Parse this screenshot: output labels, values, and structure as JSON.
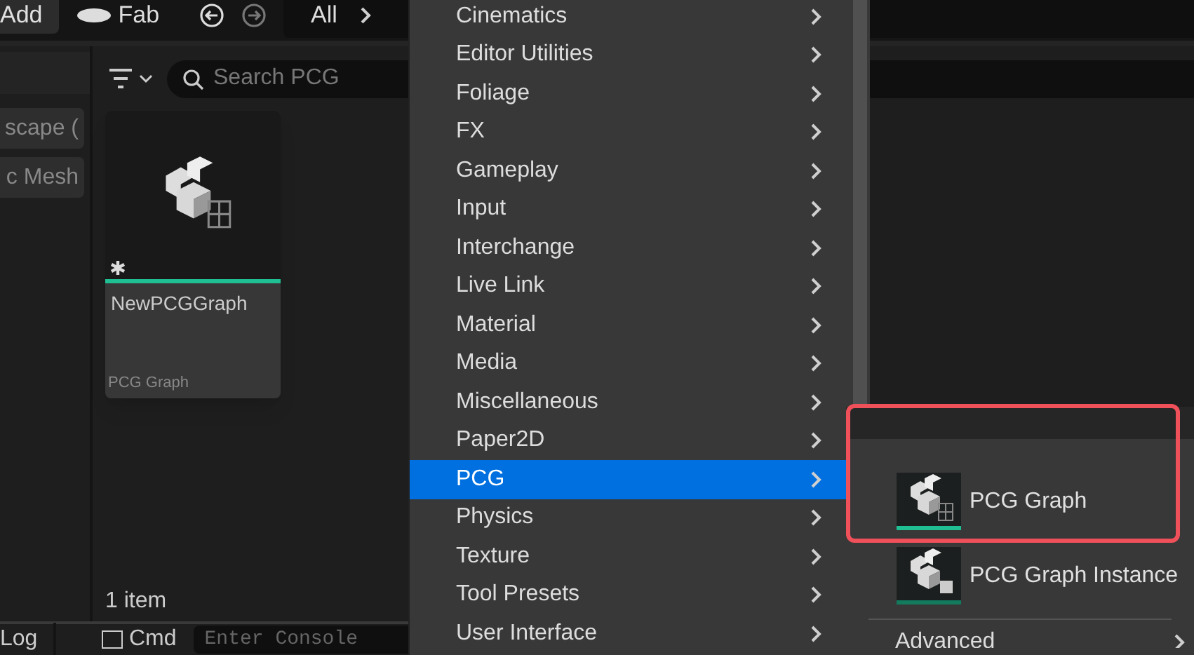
{
  "toolbar": {
    "add_button": "Add",
    "fab_button": "Fab",
    "breadcrumb": [
      "All"
    ]
  },
  "sidebar": {
    "items": [
      "scape (",
      "c Mesh"
    ]
  },
  "browser": {
    "search": {
      "placeholder": "Search PCG"
    },
    "assets": [
      {
        "name": "NewPCGGraph",
        "type": "PCG Graph",
        "unsaved": true
      }
    ],
    "item_count": "1 item"
  },
  "bottom_bar": {
    "log_tab": "Log",
    "cmd_button": "Cmd",
    "console": {
      "placeholder": "Enter Console"
    }
  },
  "menu": {
    "items": [
      {
        "label": "Cinematics",
        "selected": false
      },
      {
        "label": "Editor Utilities",
        "selected": false
      },
      {
        "label": "Foliage",
        "selected": false
      },
      {
        "label": "FX",
        "selected": false
      },
      {
        "label": "Gameplay",
        "selected": false
      },
      {
        "label": "Input",
        "selected": false
      },
      {
        "label": "Interchange",
        "selected": false
      },
      {
        "label": "Live Link",
        "selected": false
      },
      {
        "label": "Material",
        "selected": false
      },
      {
        "label": "Media",
        "selected": false
      },
      {
        "label": "Miscellaneous",
        "selected": false
      },
      {
        "label": "Paper2D",
        "selected": false
      },
      {
        "label": "PCG",
        "selected": true
      },
      {
        "label": "Physics",
        "selected": false
      },
      {
        "label": "Texture",
        "selected": false
      },
      {
        "label": "Tool Presets",
        "selected": false
      },
      {
        "label": "User Interface",
        "selected": false
      }
    ]
  },
  "submenu": {
    "items": [
      {
        "label": "PCG Graph",
        "kind": "graph",
        "highlighted": true
      },
      {
        "label": "PCG Graph Instance",
        "kind": "instance",
        "highlighted": false
      }
    ],
    "advanced": "Advanced"
  }
}
